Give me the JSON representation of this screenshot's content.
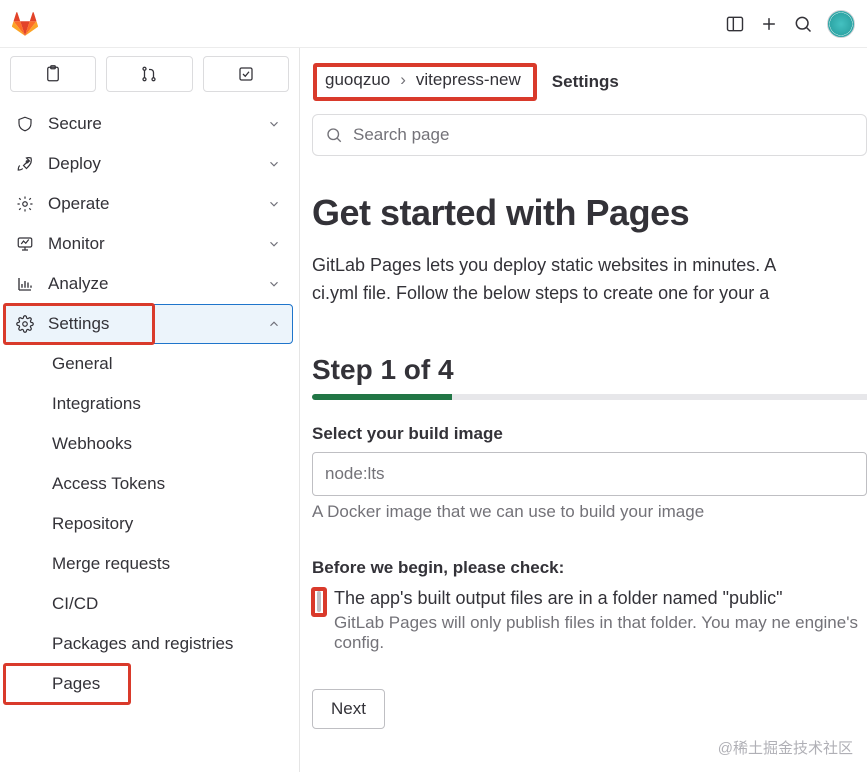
{
  "breadcrumb": {
    "owner": "guoqzuo",
    "project": "vitepress-new",
    "current": "Settings"
  },
  "search": {
    "placeholder": "Search page"
  },
  "sidebar": {
    "items": [
      {
        "icon": "shield",
        "label": "Secure"
      },
      {
        "icon": "rocket",
        "label": "Deploy"
      },
      {
        "icon": "gear-cloud",
        "label": "Operate"
      },
      {
        "icon": "monitor",
        "label": "Monitor"
      },
      {
        "icon": "chart",
        "label": "Analyze"
      },
      {
        "icon": "gear",
        "label": "Settings"
      }
    ],
    "settings_children": [
      "General",
      "Integrations",
      "Webhooks",
      "Access Tokens",
      "Repository",
      "Merge requests",
      "CI/CD",
      "Packages and registries",
      "Pages"
    ]
  },
  "page": {
    "title": "Get started with Pages",
    "lead1": "GitLab Pages lets you deploy static websites in minutes. A",
    "lead2": "ci.yml file. Follow the below steps to create one for your a",
    "step_title": "Step 1 of 4",
    "build_image_label": "Select your build image",
    "build_image_value": "node:lts",
    "build_image_help": "A Docker image that we can use to build your image",
    "check_heading": "Before we begin, please check:",
    "check_main": "The app's built output files are in a folder named \"public\"",
    "check_help": "GitLab Pages will only publish files in that folder. You may ne engine's config.",
    "next": "Next"
  },
  "watermark": "@稀土掘金技术社区"
}
